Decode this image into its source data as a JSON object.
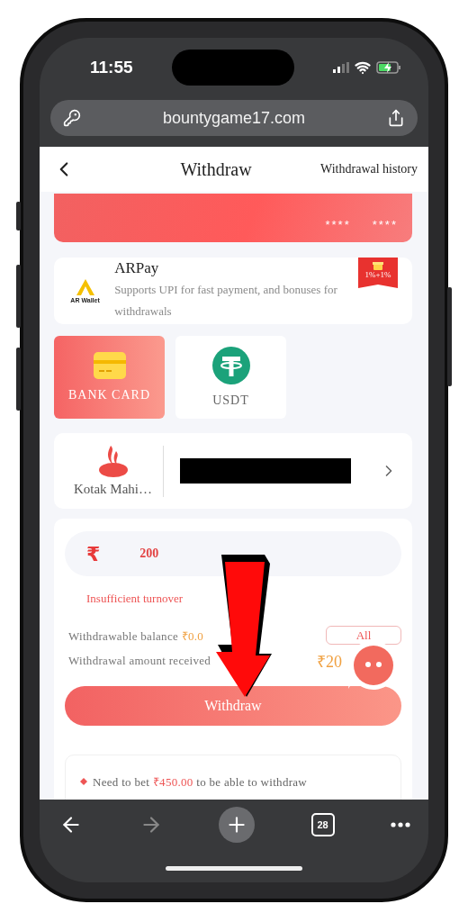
{
  "status_bar": {
    "time": "11:55"
  },
  "browser": {
    "url": "bountygame17.com",
    "tab_count": "28"
  },
  "header": {
    "title": "Withdraw",
    "history_link": "Withdrawal history"
  },
  "bank_card_banner": {
    "masked_groups": [
      "****",
      "****"
    ]
  },
  "featured_channel": {
    "name": "ARPay",
    "logo_caption": "AR Wallet",
    "description": "Supports UPI for fast payment, and bonuses for withdrawals",
    "badge": "1%+1%"
  },
  "methods": [
    {
      "label": "BANK CARD",
      "kind": "card",
      "selected": true
    },
    {
      "label": "USDT",
      "kind": "tether",
      "selected": false
    }
  ],
  "bank_account": {
    "bank_name": "Kotak Mahi…"
  },
  "amount": {
    "currency": "₹",
    "value": "200",
    "error": "Insufficient turnover"
  },
  "balance": {
    "label": "Withdrawable balance",
    "value": "₹0.0",
    "all_button": "All"
  },
  "received": {
    "label": "Withdrawal amount received",
    "value": "₹20"
  },
  "withdraw_button": "Withdraw",
  "notes": [
    {
      "before": "Need to bet",
      "amount": "₹450.00",
      "after": "to be able to withdraw"
    }
  ]
}
